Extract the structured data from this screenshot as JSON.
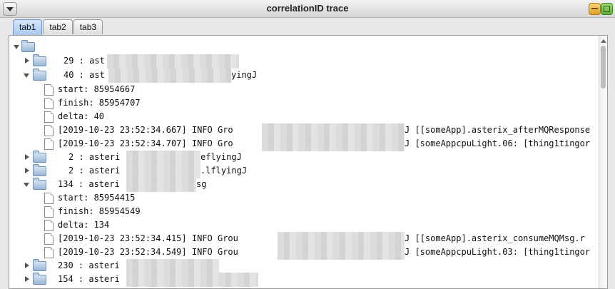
{
  "window": {
    "title": "correlationID trace"
  },
  "tabs": [
    {
      "label": "tab1",
      "active": true
    },
    {
      "label": "tab2",
      "active": false
    },
    {
      "label": "tab3",
      "active": false
    }
  ],
  "tree": {
    "node_29": {
      "text": "29 : ast"
    },
    "node_40": {
      "text": "40 : ast",
      "suffix": "yingJ",
      "start": "start: 85954667",
      "finish": "finish: 85954707",
      "delta": "delta: 40",
      "log1_prefix": "[2019-10-23 23:52:34.667] INFO    Gro",
      "log1_suffix": "J [[someApp].asterix_afterMQResponse",
      "log2_prefix": "[2019-10-23 23:52:34.707] INFO    Gro",
      "log2_suffix": "J [someAppcpuLight.06: [thing1tingor"
    },
    "node_2a": {
      "text": "2 : asteri",
      "suffix": "eflyingJ"
    },
    "node_2b": {
      "text": "2 : asteri",
      "suffix": ".lflyingJ"
    },
    "node_134": {
      "text": "134 : asteri",
      "suffix": "sg",
      "start": "start: 85954415",
      "finish": "finish: 85954549",
      "delta": "delta: 134",
      "log1_prefix": "[2019-10-23 23:52:34.415] INFO    Grou",
      "log1_suffix": "J [[someApp].asterix_consumeMQMsg.r",
      "log2_prefix": "[2019-10-23 23:52:34.549] INFO    Grou",
      "log2_suffix": "J [someAppcpuLight.03: [thing1tingor"
    },
    "node_230": {
      "text": "230 : asteri"
    },
    "node_154": {
      "text": "154 : asteri"
    }
  }
}
